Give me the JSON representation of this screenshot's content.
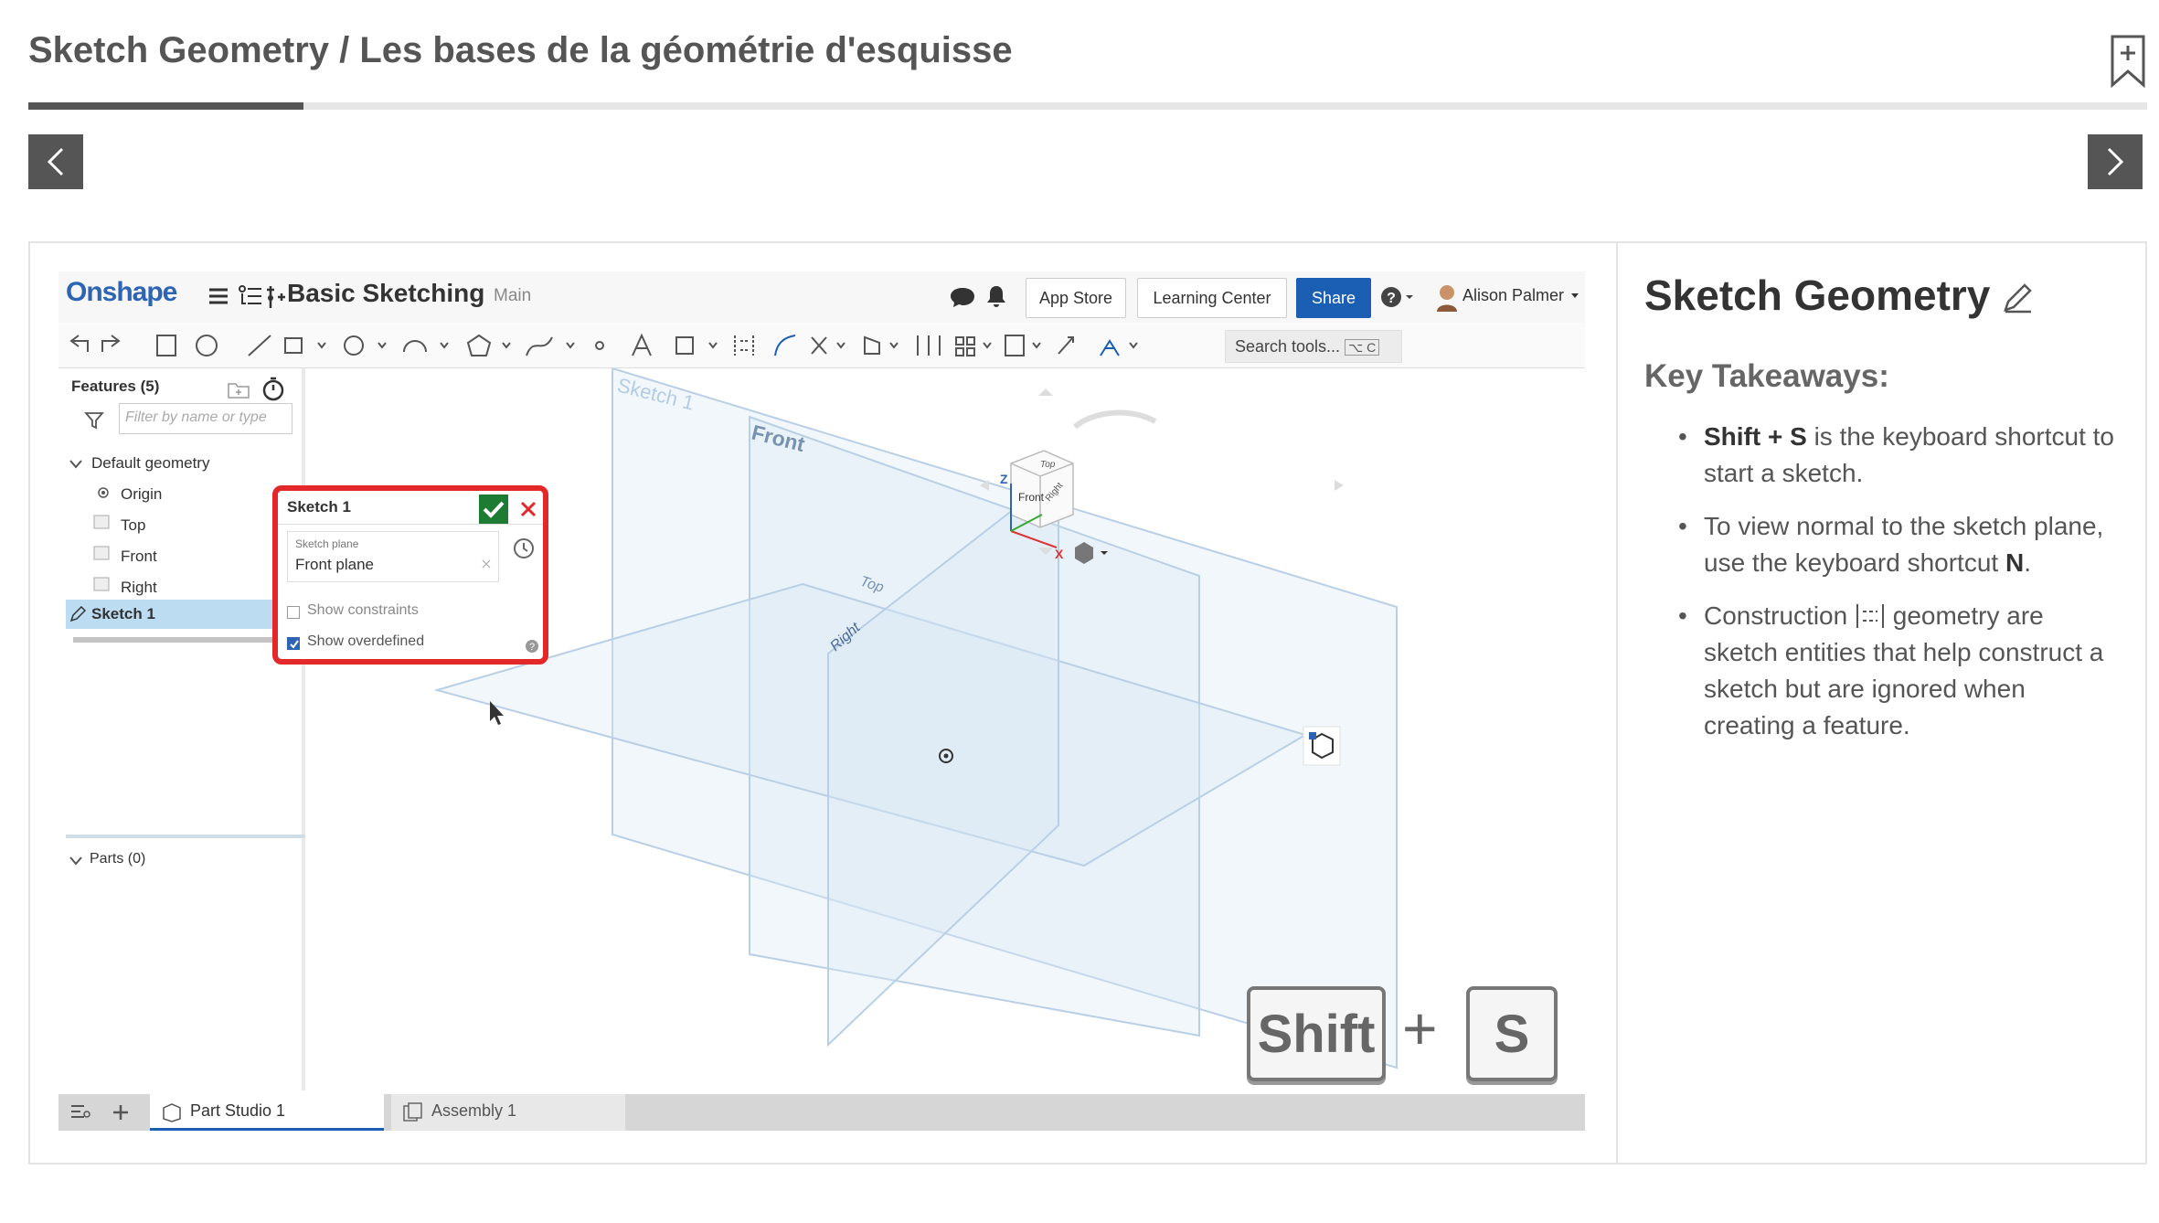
{
  "lesson": {
    "title": "Sketch Geometry / Les bases de la géométrie d'esquisse",
    "progress": 0.13
  },
  "nav": {
    "prev_icon": "chevron-left-icon",
    "next_icon": "chevron-right-icon",
    "bookmark_icon": "bookmark-add-icon"
  },
  "onshape": {
    "logo": "Onshape",
    "doc_title": "Basic Sketching",
    "branch": "Main",
    "buttons": {
      "app_store": "App Store",
      "learning_center": "Learning Center",
      "share": "Share"
    },
    "user": "Alison Palmer",
    "search_tools": "Search tools...",
    "search_shortcut": "⌥ C",
    "features_label": "Features (5)",
    "filter_placeholder": "Filter by name or type",
    "tree": {
      "default_geometry": "Default geometry",
      "items": [
        "Origin",
        "Top",
        "Front",
        "Right"
      ],
      "sketch": "Sketch 1",
      "parts": "Parts (0)"
    },
    "dialog": {
      "title": "Sketch 1",
      "field_label": "Sketch plane",
      "field_value": "Front plane",
      "show_constraints": "Show constraints",
      "show_overdefined": "Show overdefined"
    },
    "viewport": {
      "sketch_label": "Sketch 1",
      "front_label": "Front",
      "top_label": "Top",
      "right_label": "Right",
      "cube_front": "Front",
      "cube_top": "Top",
      "cube_right": "Right",
      "axis_z": "Z",
      "axis_x": "X"
    },
    "tabs": {
      "part_studio": "Part Studio 1",
      "assembly": "Assembly 1"
    },
    "keys": {
      "shift": "Shift",
      "plus": "+",
      "s": "S"
    }
  },
  "side": {
    "title": "Sketch Geometry",
    "subtitle": "Key Takeaways:",
    "t1_bold": "Shift + S",
    "t1_rest": " is the keyboard shortcut to start a sketch.",
    "t2_text": "To view normal to the sketch plane, use the keyboard shortcut ",
    "t2_bold": "N",
    "t2_end": ".",
    "t3_a": "Construction ",
    "t3_b": " geometry are sketch entities that help construct a sketch but are ignored when creating a feature."
  },
  "colors": {
    "accent": "#1a5fb4",
    "dialog_border": "#e3282a",
    "ok_green": "#1e7b34",
    "plane": "#b9cfe6"
  }
}
